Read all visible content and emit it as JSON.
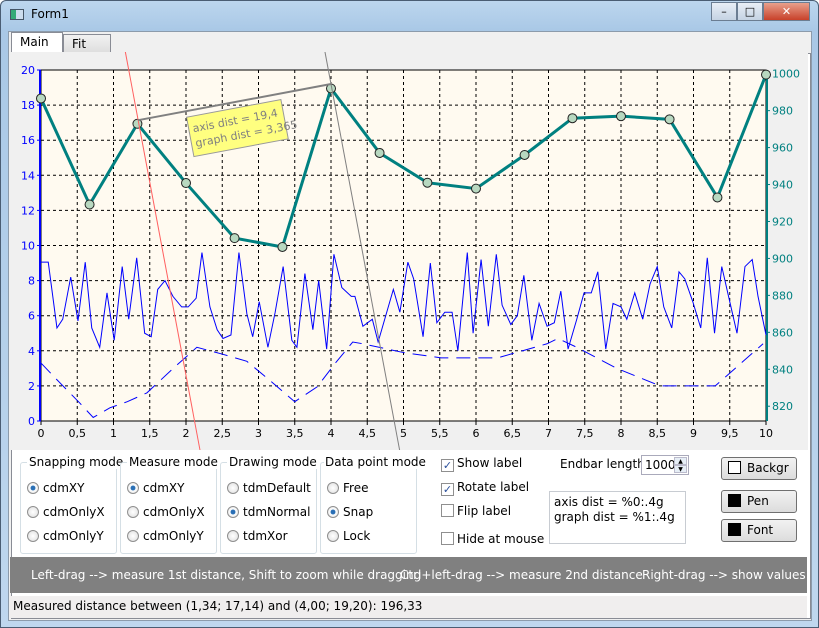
{
  "window": {
    "title": "Form1",
    "controls": [
      "minimize",
      "maximize",
      "close"
    ]
  },
  "tabs": [
    {
      "label": "Main",
      "active": true
    },
    {
      "label": "Fit",
      "active": false
    }
  ],
  "chart_data": {
    "type": "line",
    "x_axis": {
      "ticks": [
        "0",
        "0,5",
        "1",
        "1,5",
        "2",
        "2,5",
        "3",
        "3,5",
        "4",
        "4,5",
        "5",
        "5,5",
        "6",
        "6,5",
        "7",
        "7,5",
        "8",
        "8,5",
        "9",
        "9,5",
        "10"
      ],
      "range": [
        0,
        10
      ]
    },
    "left_axis": {
      "ticks": [
        "0",
        "2",
        "4",
        "6",
        "8",
        "10",
        "12",
        "14",
        "16",
        "18",
        "20"
      ],
      "range": [
        0,
        20
      ],
      "color": "#0000ff"
    },
    "right_axis": {
      "ticks": [
        "820",
        "840",
        "860",
        "880",
        "900",
        "920",
        "940",
        "960",
        "980",
        "1000"
      ],
      "range": [
        812,
        1002
      ],
      "color": "#008080"
    },
    "grid": true,
    "background": "#fffaf0",
    "series": [
      {
        "axis": "right",
        "color": "#008080",
        "markers": true,
        "x": [
          0,
          0.67,
          1.33,
          2,
          2.67,
          3.33,
          4,
          4.67,
          5.33,
          6,
          6.67,
          7.33,
          8,
          8.67,
          9.33,
          10
        ],
        "y": [
          986.6,
          929.2,
          972.9,
          940.8,
          911.0,
          906.2,
          992.0,
          957.1,
          941.0,
          937.8,
          956.0,
          975.9,
          977.0,
          975.3,
          933.0,
          999.5
        ]
      },
      {
        "axis": "left",
        "color": "#0000ff",
        "x": [
          0,
          0.1,
          0.22,
          0.3,
          0.41,
          0.51,
          0.61,
          0.7,
          0.81,
          0.91,
          1.01,
          1.12,
          1.21,
          1.32,
          1.43,
          1.52,
          1.61,
          1.71,
          1.82,
          1.94,
          2.03,
          2.14,
          2.22,
          2.33,
          2.43,
          2.51,
          2.62,
          2.73,
          2.84,
          2.92,
          3.01,
          3.13,
          3.23,
          3.34,
          3.46,
          3.53,
          3.64,
          3.75,
          3.83,
          3.94,
          4.04,
          4.15,
          4.28,
          4.33,
          4.44,
          4.57,
          4.65,
          4.86,
          4.95,
          5.06,
          5.14,
          5.27,
          5.37,
          5.46,
          5.57,
          5.67,
          5.75,
          5.88,
          5.96,
          6.07,
          6.17,
          6.28,
          6.36,
          6.48,
          6.57,
          6.66,
          6.77,
          6.87,
          6.98,
          7.08,
          7.17,
          7.27,
          7.39,
          7.49,
          7.59,
          7.68,
          7.79,
          7.89,
          8.0,
          8.08,
          8.19,
          8.3,
          8.4,
          8.5,
          8.59,
          8.7,
          8.8,
          8.88,
          8.99,
          9.1,
          9.19,
          9.29,
          9.39,
          9.5,
          9.6,
          9.71,
          9.81,
          9.89,
          10
        ],
        "y": [
          9.05,
          9.05,
          5.3,
          5.8,
          8.2,
          5.7,
          9.05,
          5.3,
          4.2,
          7.3,
          4.6,
          8.8,
          5.8,
          9.3,
          5.0,
          4.8,
          7.5,
          8.0,
          7.1,
          6.5,
          6.5,
          7.0,
          9.6,
          6.5,
          5.2,
          4.7,
          4.9,
          9.6,
          6.1,
          4.8,
          6.8,
          4.2,
          6.2,
          8.8,
          4.6,
          4.2,
          8.4,
          5.2,
          8.0,
          4.1,
          9.5,
          7.6,
          7.1,
          7.1,
          5.4,
          5.8,
          4.5,
          7.5,
          6.2,
          9.05,
          8.1,
          4.8,
          9.0,
          5.6,
          6.2,
          6.2,
          4.0,
          9.6,
          5.0,
          9.2,
          5.4,
          9.5,
          6.6,
          5.5,
          6.0,
          8.3,
          4.6,
          6.7,
          5.4,
          5.6,
          7.4,
          4.1,
          5.8,
          7.3,
          7.3,
          8.5,
          4.1,
          6.7,
          6.5,
          5.8,
          7.3,
          5.8,
          7.8,
          8.8,
          6.5,
          5.3,
          8.5,
          8.1,
          6.8,
          5.3,
          9.3,
          5.0,
          8.8,
          6.8,
          5.0,
          8.8,
          9.2,
          7.1,
          4.9
        ]
      },
      {
        "axis": "left",
        "color": "#0000ff",
        "dashed": true,
        "x": [
          0,
          0.22,
          0.54,
          0.72,
          0.95,
          1.19,
          1.46,
          1.85,
          2.15,
          2.51,
          2.84,
          3.16,
          3.5,
          3.81,
          4.06,
          4.3,
          4.44,
          5.0,
          5.52,
          6.3,
          6.98,
          7.13,
          7.39,
          7.94,
          8.54,
          9.3,
          9.96
        ],
        "y": [
          3.3,
          2.35,
          1.0,
          0.2,
          0.75,
          1.1,
          1.6,
          3.1,
          4.2,
          3.8,
          3.4,
          2.3,
          1.1,
          1.95,
          3.3,
          4.5,
          4.4,
          3.9,
          3.6,
          3.6,
          4.4,
          4.7,
          4.2,
          3.0,
          2.0,
          2.0,
          4.4
        ]
      }
    ],
    "measurement": {
      "p1": [
        1.34,
        17.14
      ],
      "p2": [
        4.0,
        19.2
      ],
      "label_lines": [
        "axis dist = 19,4",
        "graph dist = 3,365"
      ],
      "label_color": "#ffff80"
    }
  },
  "controls": {
    "snapping": {
      "title": "Snapping mode",
      "options": [
        "cdmXY",
        "cdmOnlyX",
        "cdmOnlyY"
      ],
      "selected": 0
    },
    "measure": {
      "title": "Measure mode",
      "options": [
        "cdmXY",
        "cdmOnlyX",
        "cdmOnlyY"
      ],
      "selected": 0
    },
    "drawing": {
      "title": "Drawing mode",
      "options": [
        "tdmDefault",
        "tdmNormal",
        "tdmXor"
      ],
      "selected": 1
    },
    "datapoint": {
      "title": "Data point mode",
      "options": [
        "Free",
        "Snap",
        "Lock"
      ],
      "selected": 1
    },
    "checks": [
      {
        "label": "Show label",
        "checked": true
      },
      {
        "label": "Rotate label",
        "checked": true
      },
      {
        "label": "Flip label",
        "checked": false
      },
      {
        "label": "Hide at mouse up",
        "checked": false
      }
    ],
    "endbar": {
      "label": "Endbar length",
      "value": "1000"
    },
    "format_text": [
      "axis dist = %0:.4g",
      "graph dist = %1:.4g"
    ],
    "buttons": [
      {
        "label": "Backgr",
        "swatch": "#ffffff"
      },
      {
        "label": "Pen",
        "swatch": "#000000"
      },
      {
        "label": "Font",
        "swatch": "#000000"
      }
    ]
  },
  "banner": [
    "Left-drag --> measure 1st distance, Shift to zoom while dragging",
    "Ctrl+left-drag --> measure 2nd distance",
    "Right-drag --> show values"
  ],
  "status": "Measured distance between (1,34; 17,14) and (4,00; 19,20): 196,33"
}
